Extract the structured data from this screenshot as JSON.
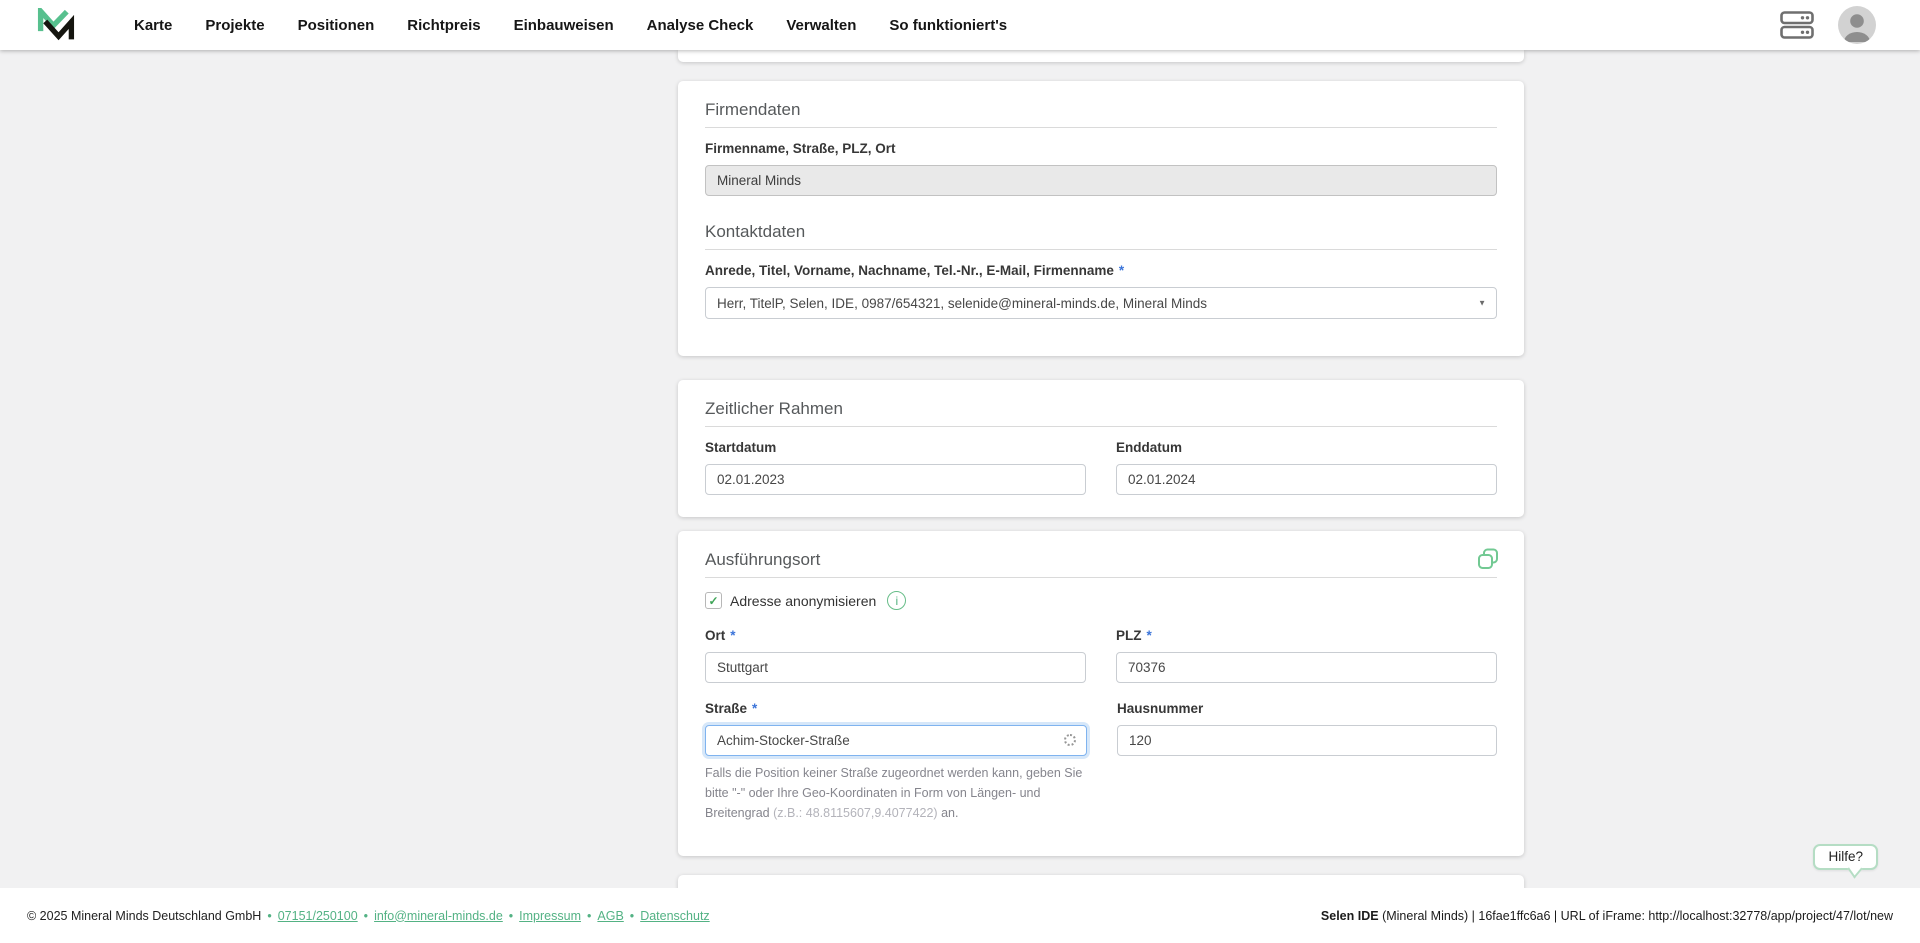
{
  "nav": {
    "items": [
      "Karte",
      "Projekte",
      "Positionen",
      "Richtpreis",
      "Einbauweisen",
      "Analyse Check",
      "Verwalten",
      "So funktioniert's"
    ]
  },
  "ui": {
    "required_mark": "*",
    "select_caret": "▼",
    "check_mark": "✓",
    "info_glyph": "i"
  },
  "firmendaten": {
    "title": "Firmendaten",
    "company_label": "Firmenname, Straße, PLZ, Ort",
    "company_value": "Mineral Minds",
    "kontakt_title": "Kontaktdaten",
    "kontakt_label": "Anrede, Titel, Vorname, Nachname, Tel.-Nr., E-Mail, Firmenname",
    "kontakt_value": "Herr, TitelP, Selen, IDE, 0987/654321, selenide@mineral-minds.de, Mineral Minds"
  },
  "zeitraum": {
    "title": "Zeitlicher Rahmen",
    "start_label": "Startdatum",
    "start_value": "02.01.2023",
    "end_label": "Enddatum",
    "end_value": "02.01.2024"
  },
  "ausfuehrungsort": {
    "title": "Ausführungsort",
    "anonymize_label": "Adresse anonymisieren",
    "ort_label": "Ort",
    "ort_value": "Stuttgart",
    "plz_label": "PLZ",
    "plz_value": "70376",
    "strasse_label": "Straße",
    "strasse_value": "Achim-Stocker-Straße",
    "hausnummer_label": "Hausnummer",
    "hausnummer_value": "120",
    "hint_text": "Falls die Position keiner Straße zugeordnet werden kann, geben Sie bitte \"-\" oder Ihre Geo-Koordinaten in Form von Längen- und Breitengrad ",
    "hint_example": "(z.B.: 48.8115607,9.4077422)",
    "hint_suffix": " an."
  },
  "footer": {
    "copyright": "© 2025 Mineral Minds Deutschland GmbH",
    "separator": "•",
    "links": [
      "07151/250100",
      "info@mineral-minds.de",
      "Impressum",
      "AGB",
      "Datenschutz"
    ],
    "ide_bold": "Selen IDE",
    "ide_rest": " (Mineral Minds) | 16fae1ffc6a6 | URL of iFrame: http://localhost:32778/app/project/47/lot/new"
  },
  "help": {
    "label": "Hilfe?"
  },
  "colors": {
    "brand_green": "#57c08e",
    "link_green": "#53b284",
    "icon_green": "#72c993",
    "required_blue": "#3b74d9",
    "focus_blue": "#7fb3ef",
    "background": "#f1f1f2"
  }
}
